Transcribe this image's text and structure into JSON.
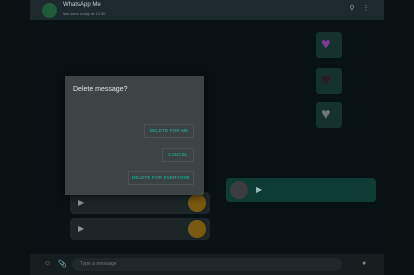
{
  "header": {
    "contact_name": "WhatsApp Me",
    "contact_status": "last seen today at 12:50",
    "icons": [
      "search-icon",
      "menu-icon"
    ]
  },
  "input_bar": {
    "placeholder": "Type a message",
    "icons": [
      "emoji-icon",
      "attach-icon",
      "mic-icon"
    ]
  },
  "dialog": {
    "title": "Delete message?",
    "buttons": {
      "delete_for_me": "DELETE FOR ME",
      "cancel": "CANCEL",
      "delete_for_everyone": "DELETE FOR EVERYONE"
    }
  },
  "colors": {
    "accent": "#19c2a8",
    "dialog_bg": "#3e4446",
    "overlay": "#0a1416"
  }
}
